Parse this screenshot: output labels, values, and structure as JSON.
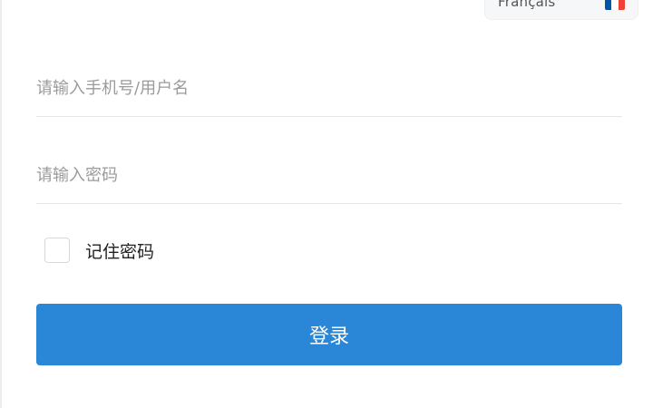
{
  "language": {
    "label": "Français",
    "flag_icon": "france-flag-icon",
    "flag_colors": [
      "#0055a4",
      "#ffffff",
      "#ef4135"
    ]
  },
  "form": {
    "username_placeholder": "请输入手机号/用户名",
    "username_value": "",
    "password_placeholder": "请输入密码",
    "password_value": "",
    "remember_label": "记住密码",
    "remember_checked": false,
    "login_label": "登录"
  },
  "colors": {
    "primary": "#2a86d6",
    "divider": "#e4e6ea",
    "placeholder": "#9b9b9b"
  }
}
